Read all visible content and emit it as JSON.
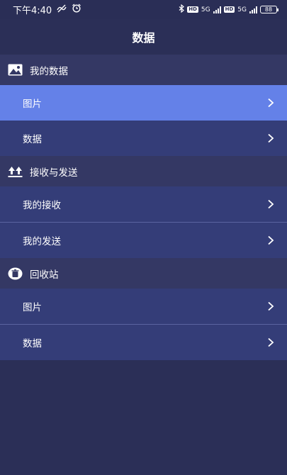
{
  "status_bar": {
    "time": "下午4:40",
    "network_1": "5G",
    "network_2": "5G",
    "hd_1": "HD",
    "hd_2": "HD",
    "battery": "88"
  },
  "header": {
    "title": "数据"
  },
  "sections": [
    {
      "title": "我的数据",
      "icon": "image-icon",
      "items": [
        {
          "label": "图片",
          "active": true
        },
        {
          "label": "数据",
          "active": false
        }
      ]
    },
    {
      "title": "接收与发送",
      "icon": "transfer-arrows-icon",
      "items": [
        {
          "label": "我的接收",
          "active": false
        },
        {
          "label": "我的发送",
          "active": false
        }
      ]
    },
    {
      "title": "回收站",
      "icon": "trash-icon",
      "items": [
        {
          "label": "图片",
          "active": false
        },
        {
          "label": "数据",
          "active": false
        }
      ]
    }
  ],
  "colors": {
    "background": "#2b2f57",
    "section_header": "#343864",
    "row": "#343d78",
    "active_row": "#6481e8"
  }
}
